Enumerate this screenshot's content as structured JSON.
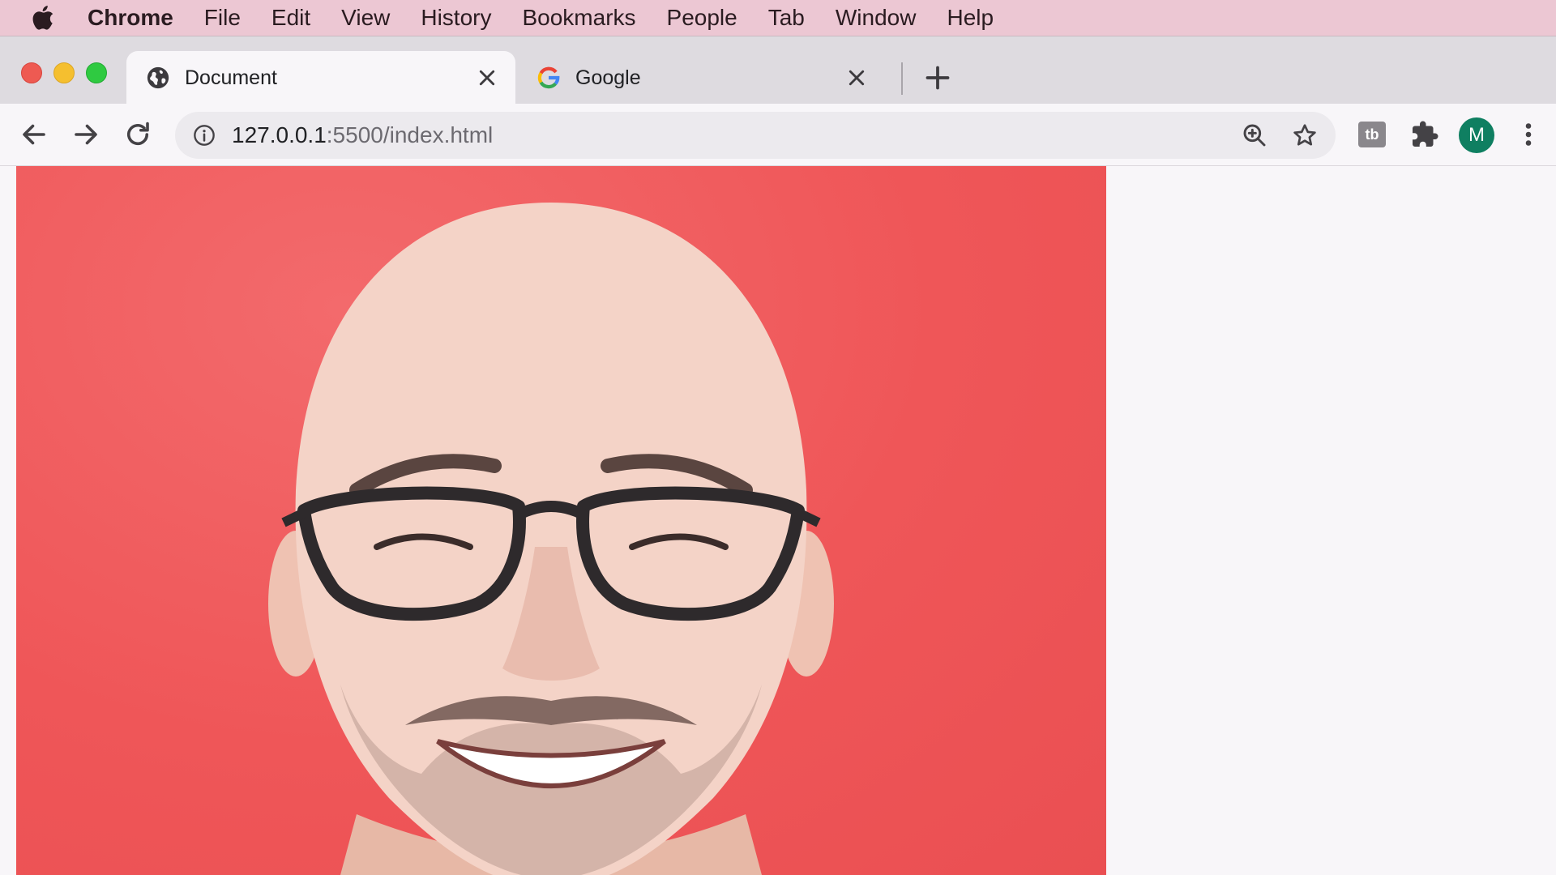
{
  "menubar": {
    "app_name": "Chrome",
    "items": [
      "File",
      "Edit",
      "View",
      "History",
      "Bookmarks",
      "People",
      "Tab",
      "Window",
      "Help"
    ]
  },
  "tabs": [
    {
      "title": "Document",
      "icon": "globe-icon",
      "active": true
    },
    {
      "title": "Google",
      "icon": "google-icon",
      "active": false
    }
  ],
  "omnibox": {
    "url_host": "127.0.0.1",
    "url_rest": ":5500/index.html"
  },
  "profile": {
    "initial": "M",
    "color": "#0f7f61"
  },
  "extension": {
    "label": "tb"
  },
  "page": {
    "image": "portrait-photo",
    "background_color": "#ef5658"
  }
}
